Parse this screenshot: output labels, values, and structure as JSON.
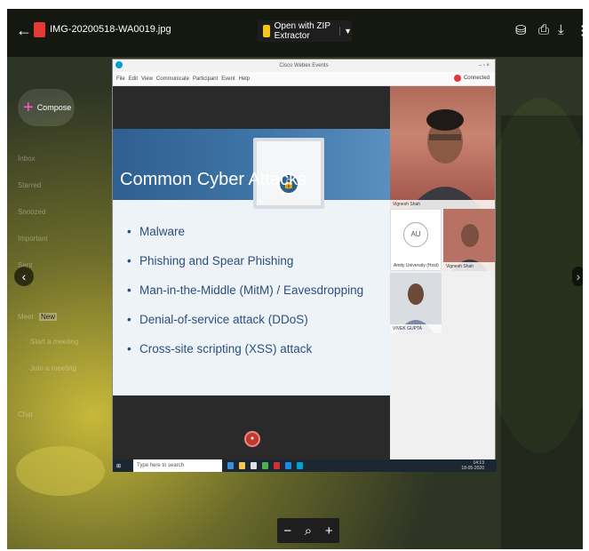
{
  "viewer": {
    "file_name": "IMG-20200518-WA0019.jpg",
    "open_with_label": "Open with ZIP Extractor",
    "icons": [
      "back-arrow-icon",
      "add-to-drive-icon",
      "print-icon",
      "download-icon",
      "more-icon"
    ]
  },
  "gmail": {
    "compose_label": "Compose",
    "items": [
      "Inbox",
      "Starred",
      "Snoozed",
      "Important",
      "Sent"
    ],
    "meet_label": "Meet",
    "meet_badge": "New",
    "meet_items": [
      "Start a meeting",
      "Join a meeting"
    ],
    "chat_label": "Chat"
  },
  "webex": {
    "title": "Cisco Webex Events",
    "menu": [
      "File",
      "Edit",
      "View",
      "Communicate",
      "Participant",
      "Event",
      "Help"
    ],
    "status": "Connected"
  },
  "slide": {
    "title": "Common Cyber Attacks",
    "bullets": [
      "Malware",
      "Phishing and Spear Phishing",
      "Man-in-the-Middle (MitM) / Eavesdropping",
      "Denial-of-service attack (DDoS)",
      "Cross-site scripting (XSS) attack"
    ]
  },
  "participants": {
    "host_name": "Vignesh Shah",
    "au_initials": "AU",
    "au_name": "Amity University (Host)",
    "thumb_name": "Vignesh Shah",
    "third_name": "VIVEK GUPTA"
  },
  "taskbar": {
    "search_placeholder": "Type here to search",
    "time": "14:13",
    "date": "18-05-2020"
  },
  "zoom": {
    "minus": "−",
    "plus": "+"
  }
}
